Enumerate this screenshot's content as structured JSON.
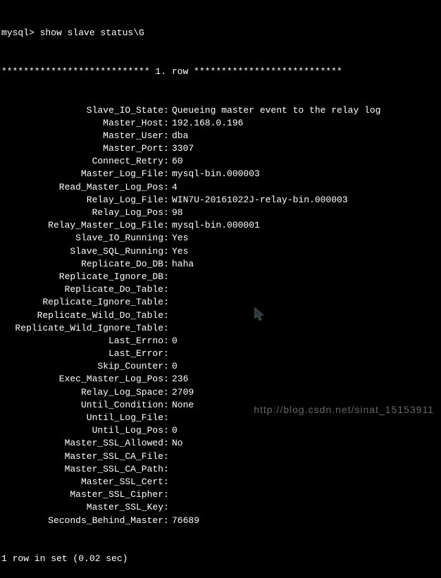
{
  "prompt": "mysql> ",
  "command": "show slave status\\G",
  "row_header": "*************************** 1. row ***************************",
  "rows": [
    {
      "label": "Slave_IO_State",
      "value": "Queueing master event to the relay log"
    },
    {
      "label": "Master_Host",
      "value": "192.168.0.196"
    },
    {
      "label": "Master_User",
      "value": "dba"
    },
    {
      "label": "Master_Port",
      "value": "3307"
    },
    {
      "label": "Connect_Retry",
      "value": "60"
    },
    {
      "label": "Master_Log_File",
      "value": "mysql-bin.000003"
    },
    {
      "label": "Read_Master_Log_Pos",
      "value": "4"
    },
    {
      "label": "Relay_Log_File",
      "value": "WIN7U-20161022J-relay-bin.000003"
    },
    {
      "label": "Relay_Log_Pos",
      "value": "98"
    },
    {
      "label": "Relay_Master_Log_File",
      "value": "mysql-bin.000001"
    },
    {
      "label": "Slave_IO_Running",
      "value": "Yes"
    },
    {
      "label": "Slave_SQL_Running",
      "value": "Yes"
    },
    {
      "label": "Replicate_Do_DB",
      "value": "haha"
    },
    {
      "label": "Replicate_Ignore_DB",
      "value": ""
    },
    {
      "label": "Replicate_Do_Table",
      "value": ""
    },
    {
      "label": "Replicate_Ignore_Table",
      "value": ""
    },
    {
      "label": "Replicate_Wild_Do_Table",
      "value": ""
    },
    {
      "label": "Replicate_Wild_Ignore_Table",
      "value": ""
    },
    {
      "label": "Last_Errno",
      "value": "0"
    },
    {
      "label": "Last_Error",
      "value": ""
    },
    {
      "label": "Skip_Counter",
      "value": "0"
    },
    {
      "label": "Exec_Master_Log_Pos",
      "value": "236"
    },
    {
      "label": "Relay_Log_Space",
      "value": "2709"
    },
    {
      "label": "Until_Condition",
      "value": "None"
    },
    {
      "label": "Until_Log_File",
      "value": ""
    },
    {
      "label": "Until_Log_Pos",
      "value": "0"
    },
    {
      "label": "Master_SSL_Allowed",
      "value": "No"
    },
    {
      "label": "Master_SSL_CA_File",
      "value": ""
    },
    {
      "label": "Master_SSL_CA_Path",
      "value": ""
    },
    {
      "label": "Master_SSL_Cert",
      "value": ""
    },
    {
      "label": "Master_SSL_Cipher",
      "value": ""
    },
    {
      "label": "Master_SSL_Key",
      "value": ""
    },
    {
      "label": "Seconds_Behind_Master",
      "value": "76689"
    }
  ],
  "footer": "1 row in set (0.02 sec)",
  "watermark": "http://blog.csdn.net/sinat_15153911"
}
